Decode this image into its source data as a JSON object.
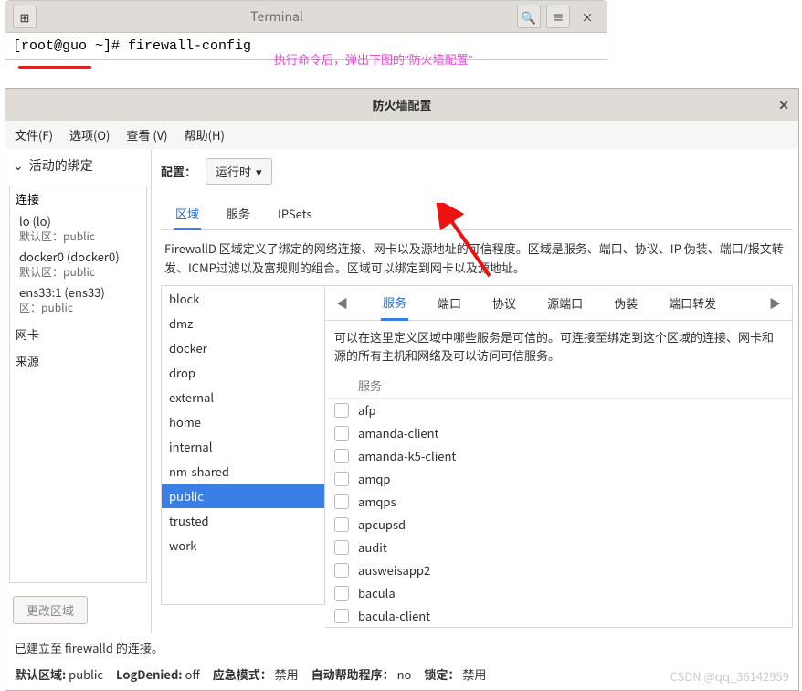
{
  "terminal": {
    "title": "Terminal",
    "prompt": "[root@guo ~]# firewall-config",
    "note": "执行命令后，弹出下图的\"防火墙配置\""
  },
  "window": {
    "title": "防火墙配置"
  },
  "menubar": {
    "file": "文件(F)",
    "options": "选项(O)",
    "view": "查看 (V)",
    "help": "帮助(H)"
  },
  "sidebar": {
    "header": "活动的绑定",
    "sections": {
      "connections": "连接",
      "interfaces": "网卡",
      "sources": "来源"
    },
    "connections": [
      {
        "name": "lo (lo)",
        "sub": "默认区：public"
      },
      {
        "name": "docker0 (docker0)",
        "sub": "默认区：public"
      },
      {
        "name": "ens33:1 (ens33)",
        "sub": "区：public"
      }
    ],
    "change_zone": "更改区域"
  },
  "config": {
    "label": "配置：",
    "value": "运行时"
  },
  "main_tabs": {
    "zone": "区域",
    "service": "服务",
    "ipsets": "IPSets"
  },
  "zone_desc": "FirewallD 区域定义了绑定的网络连接、网卡以及源地址的可信程度。区域是服务、端口、协议、IP 伪装、端口/报文转发、ICMP过滤以及富规则的组合。区域可以绑定到网卡以及源地址。",
  "zones": [
    "block",
    "dmz",
    "docker",
    "drop",
    "external",
    "home",
    "internal",
    "nm-shared",
    "public",
    "trusted",
    "work"
  ],
  "zone_selected": "public",
  "inner_tabs": {
    "services": "服务",
    "ports": "端口",
    "protocols": "协议",
    "source_ports": "源端口",
    "masquerade": "伪装",
    "port_forward": "端口转发"
  },
  "service_desc": "可以在这里定义区域中哪些服务是可信的。可连接至绑定到这个区域的连接、网卡和源的所有主机和网络及可以访问可信服务。",
  "service_header": "服务",
  "services": [
    "afp",
    "amanda-client",
    "amanda-k5-client",
    "amqp",
    "amqps",
    "apcupsd",
    "audit",
    "ausweisapp2",
    "bacula",
    "bacula-client"
  ],
  "status": {
    "line1": "已建立至 firewalld 的连接。",
    "default_zone_label": "默认区域:",
    "default_zone_value": "public",
    "log_denied_label": "LogDenied:",
    "log_denied_value": "off",
    "panic_label": "应急模式：",
    "panic_value": "禁用",
    "auto_helpers_label": "自动帮助程序：",
    "auto_helpers_value": "no",
    "lockdown_label": "锁定：",
    "lockdown_value": "禁用"
  },
  "watermark": "CSDN @qq_36142959"
}
